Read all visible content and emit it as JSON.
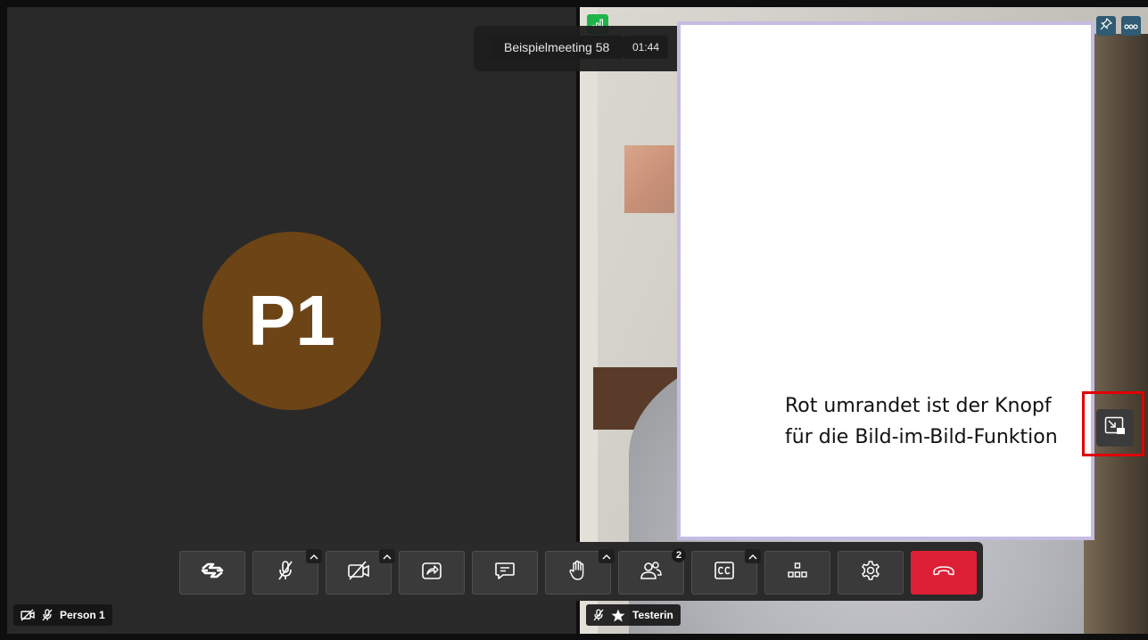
{
  "meeting": {
    "title": "Beispielmeeting 58",
    "duration": "01:44"
  },
  "participants": {
    "left": {
      "initials": "P1",
      "name": "Person 1",
      "avatar_color": "#6c4416"
    },
    "right": {
      "name": "Testerin"
    }
  },
  "annotation": {
    "line1": "Rot umrandet ist der Knopf",
    "line2": "für die Bild-im-Bild-Funktion",
    "highlight_color": "#e00000"
  },
  "toolbar": {
    "buttons": [
      {
        "name": "whiteboard-button",
        "icon": "handshake-icon"
      },
      {
        "name": "microphone-button",
        "icon": "microphone-off-icon"
      },
      {
        "name": "camera-button",
        "icon": "camera-off-icon"
      },
      {
        "name": "share-screen-button",
        "icon": "share-icon"
      },
      {
        "name": "chat-button",
        "icon": "chat-icon"
      },
      {
        "name": "raise-hand-button",
        "icon": "hand-icon"
      },
      {
        "name": "participants-button",
        "icon": "people-icon"
      },
      {
        "name": "captions-button",
        "icon": "cc-icon"
      },
      {
        "name": "breakout-rooms-button",
        "icon": "hierarchy-icon"
      },
      {
        "name": "settings-button",
        "icon": "gear-icon"
      },
      {
        "name": "hangup-button",
        "icon": "phone-hangup-icon"
      }
    ],
    "participant_count": "2",
    "hangup_color": "#dd2035"
  },
  "colors": {
    "signal": "#1fb44a",
    "tile_bg": "#292929",
    "panel_border": "#c4bce2"
  }
}
